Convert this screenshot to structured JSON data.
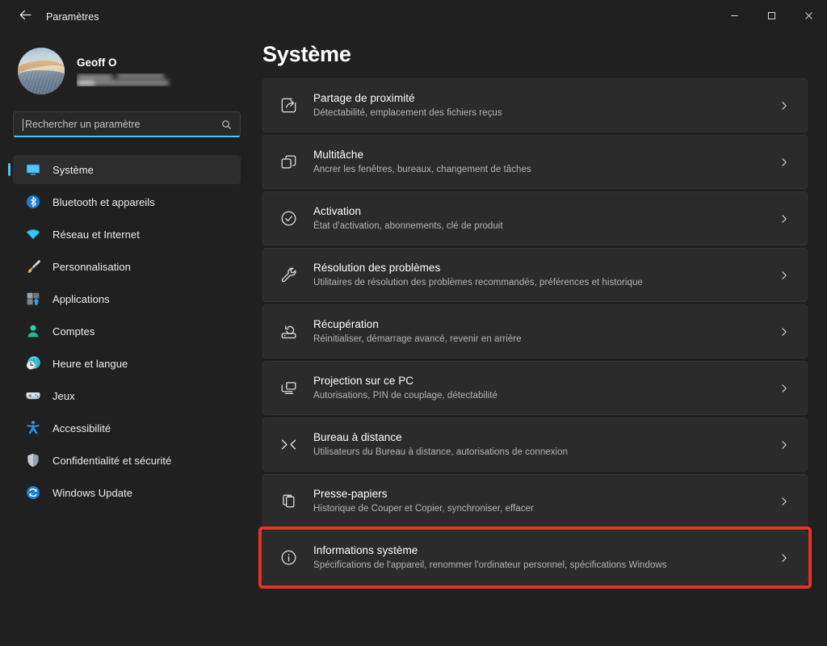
{
  "window": {
    "title": "Paramètres",
    "back_label": "Retour",
    "controls": {
      "minimize": "Réduire",
      "maximize": "Agrandir",
      "close": "Fermer"
    }
  },
  "account": {
    "name": "Geoff O",
    "email_redacted": ""
  },
  "search": {
    "placeholder": "Rechercher un paramètre",
    "value": "",
    "accent": "#4cc2ff"
  },
  "sidebar": {
    "items": [
      {
        "label": "Système",
        "icon": "monitor-icon",
        "selected": true
      },
      {
        "label": "Bluetooth et appareils",
        "icon": "bluetooth-icon",
        "selected": false
      },
      {
        "label": "Réseau et Internet",
        "icon": "wifi-icon",
        "selected": false
      },
      {
        "label": "Personnalisation",
        "icon": "paintbrush-icon",
        "selected": false
      },
      {
        "label": "Applications",
        "icon": "apps-grid-icon",
        "selected": false
      },
      {
        "label": "Comptes",
        "icon": "person-icon",
        "selected": false
      },
      {
        "label": "Heure et langue",
        "icon": "clock-globe-icon",
        "selected": false
      },
      {
        "label": "Jeux",
        "icon": "gamepad-icon",
        "selected": false
      },
      {
        "label": "Accessibilité",
        "icon": "accessibility-icon",
        "selected": false
      },
      {
        "label": "Confidentialité et sécurité",
        "icon": "shield-icon",
        "selected": false
      },
      {
        "label": "Windows Update",
        "icon": "update-refresh-icon",
        "selected": false
      }
    ]
  },
  "main": {
    "heading": "Système",
    "highlight_color": "#ea3323",
    "items": [
      {
        "title": "Partage de proximité",
        "subtitle": "Détectabilité, emplacement des fichiers reçus",
        "icon": "share-icon",
        "highlighted": false
      },
      {
        "title": "Multitâche",
        "subtitle": "Ancrer les fenêtres, bureaux, changement de tâches",
        "icon": "windows-stack-icon",
        "highlighted": false
      },
      {
        "title": "Activation",
        "subtitle": "État d'activation, abonnements, clé de produit",
        "icon": "check-circle-icon",
        "highlighted": false
      },
      {
        "title": "Résolution des problèmes",
        "subtitle": "Utilitaires de résolution des problèmes recommandés, préférences et historique",
        "icon": "wrench-icon",
        "highlighted": false
      },
      {
        "title": "Récupération",
        "subtitle": "Réinitialiser, démarrage avancé, revenir en arrière",
        "icon": "recovery-icon",
        "highlighted": false
      },
      {
        "title": "Projection sur ce PC",
        "subtitle": "Autorisations, PIN de couplage, détectabilité",
        "icon": "project-screen-icon",
        "highlighted": false
      },
      {
        "title": "Bureau à distance",
        "subtitle": "Utilisateurs du Bureau à distance, autorisations de connexion",
        "icon": "remote-desktop-icon",
        "highlighted": false
      },
      {
        "title": "Presse-papiers",
        "subtitle": "Historique de Couper et Copier, synchroniser, effacer",
        "icon": "clipboard-icon",
        "highlighted": false
      },
      {
        "title": "Informations système",
        "subtitle": "Spécifications de l'appareil, renommer l'ordinateur personnel, spécifications Windows",
        "icon": "info-circle-icon",
        "highlighted": true
      }
    ]
  }
}
